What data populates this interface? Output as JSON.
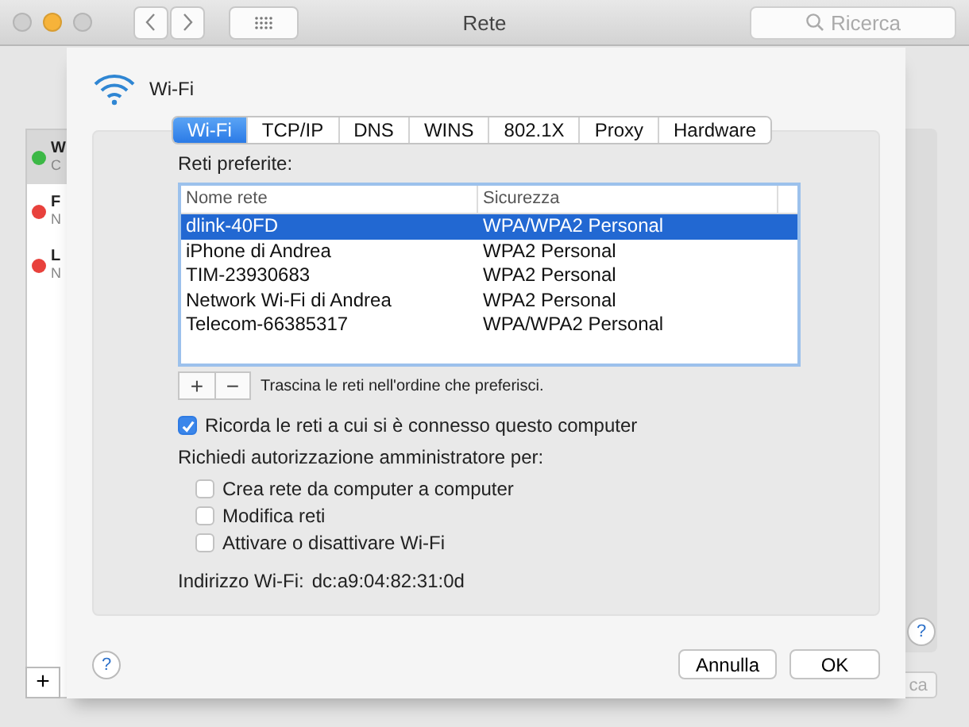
{
  "window": {
    "title": "Rete",
    "search": {
      "placeholder": "Ricerca"
    }
  },
  "sidebar": {
    "items": [
      {
        "name": "W",
        "detail": "C",
        "color": "#3cb846",
        "selected": true
      },
      {
        "name": "F",
        "detail": "N",
        "color": "#e8413c",
        "selected": false
      },
      {
        "name": "L",
        "detail": "N",
        "color": "#e8413c",
        "selected": false
      }
    ],
    "add": "+"
  },
  "background": {
    "help": "?",
    "button": "ca"
  },
  "sheet": {
    "title": "Wi-Fi",
    "tabs": [
      {
        "label": "Wi-Fi",
        "selected": true
      },
      {
        "label": "TCP/IP",
        "selected": false
      },
      {
        "label": "DNS",
        "selected": false
      },
      {
        "label": "WINS",
        "selected": false
      },
      {
        "label": "802.1X",
        "selected": false
      },
      {
        "label": "Proxy",
        "selected": false
      },
      {
        "label": "Hardware",
        "selected": false
      }
    ],
    "preferred_label": "Reti preferite:",
    "table": {
      "columns": [
        "Nome rete",
        "Sicurezza"
      ],
      "rows": [
        {
          "name": "dlink-40FD",
          "security": "WPA/WPA2 Personal",
          "selected": true
        },
        {
          "name": "iPhone di Andrea",
          "security": "WPA2 Personal",
          "selected": false
        },
        {
          "name": "TIM-23930683",
          "security": "WPA2 Personal",
          "selected": false
        },
        {
          "name": "Network Wi-Fi di Andrea",
          "security": "WPA2 Personal",
          "selected": false
        },
        {
          "name": "Telecom-66385317",
          "security": "WPA/WPA2 Personal",
          "selected": false
        }
      ]
    },
    "add": "+",
    "remove": "−",
    "drag_hint": "Trascina le reti nell'ordine che preferisci.",
    "remember": {
      "label": "Ricorda le reti a cui si è connesso questo computer",
      "checked": true
    },
    "admin_label": "Richiedi autorizzazione amministratore per:",
    "admin_options": [
      {
        "label": "Crea rete da computer a computer",
        "checked": false
      },
      {
        "label": "Modifica reti",
        "checked": false
      },
      {
        "label": "Attivare o disattivare Wi-Fi",
        "checked": false
      }
    ],
    "address_label": "Indirizzo Wi-Fi:",
    "address": "dc:a9:04:82:31:0d",
    "help": "?",
    "buttons": [
      {
        "label": "Annulla",
        "kind": "cancel"
      },
      {
        "label": "OK",
        "kind": "default"
      }
    ]
  }
}
